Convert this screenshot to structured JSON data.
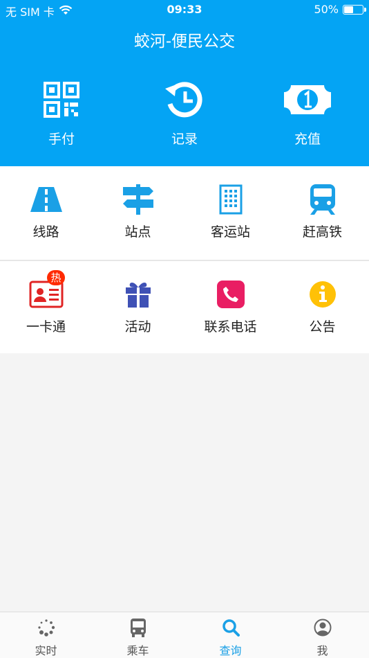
{
  "status_bar": {
    "carrier": "无 SIM 卡",
    "time": "09:33",
    "battery": "50%"
  },
  "header": {
    "title": "蛟河-便民公交"
  },
  "quick_actions": [
    {
      "label": "手付",
      "icon": "qr-code-icon"
    },
    {
      "label": "记录",
      "icon": "history-icon"
    },
    {
      "label": "充值",
      "icon": "money-icon"
    }
  ],
  "grid_row1": [
    {
      "label": "线路",
      "icon": "road-icon"
    },
    {
      "label": "站点",
      "icon": "signpost-icon"
    },
    {
      "label": "客运站",
      "icon": "building-icon"
    },
    {
      "label": "赶高铁",
      "icon": "train-icon"
    }
  ],
  "grid_row2": [
    {
      "label": "一卡通",
      "icon": "id-card-icon",
      "badge": "热"
    },
    {
      "label": "活动",
      "icon": "gift-icon"
    },
    {
      "label": "联系电话",
      "icon": "phone-icon"
    },
    {
      "label": "公告",
      "icon": "info-icon"
    }
  ],
  "tabs": [
    {
      "label": "实时",
      "icon": "loading-icon"
    },
    {
      "label": "乘车",
      "icon": "bus-icon"
    },
    {
      "label": "查询",
      "icon": "search-icon",
      "active": true
    },
    {
      "label": "我",
      "icon": "user-icon"
    }
  ],
  "colors": {
    "header_bg": "#04a4f4",
    "accent_blue": "#1aa0e6",
    "card_red": "#e02424",
    "gift_indigo": "#3f51b5",
    "phone_pink": "#e91e63",
    "info_yellow": "#ffc107",
    "hot_badge": "#ff2a00"
  }
}
